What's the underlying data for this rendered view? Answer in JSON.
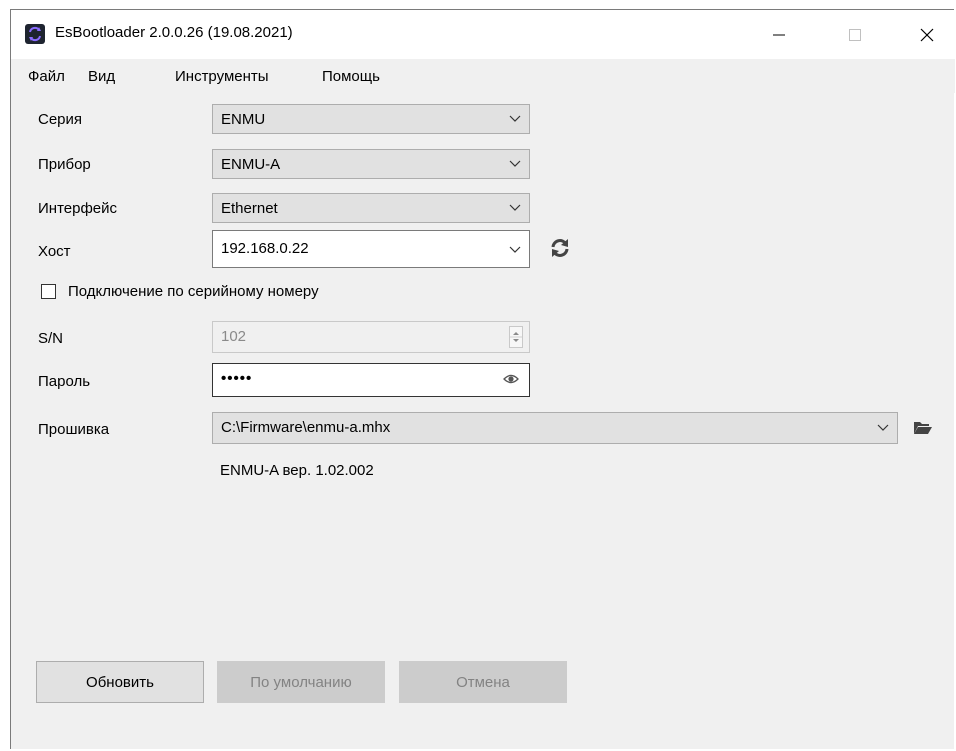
{
  "window": {
    "title": "EsBootloader 2.0.0.26 (19.08.2021)"
  },
  "menu": {
    "items": [
      "Файл",
      "Вид",
      "Инструменты",
      "Помощь"
    ]
  },
  "form": {
    "series_label": "Серия",
    "series_value": "ENMU",
    "device_label": "Прибор",
    "device_value": "ENMU-A",
    "interface_label": "Интерфейс",
    "interface_value": "Ethernet",
    "host_label": "Хост",
    "host_value": "192.168.0.22",
    "serial_checkbox_label": "Подключение по серийному номеру",
    "serial_checked": false,
    "sn_label": "S/N",
    "sn_value": "102",
    "password_label": "Пароль",
    "password_value": "•••••",
    "firmware_label": "Прошивка",
    "firmware_value": "C:\\Firmware\\enmu-a.mhx",
    "firmware_info": "ENMU-A вер. 1.02.002"
  },
  "buttons": {
    "update": "Обновить",
    "defaults": "По умолчанию",
    "cancel": "Отмена"
  },
  "icons": {
    "app": "app-icon",
    "refresh": "refresh-icon",
    "eye": "eye-icon",
    "folder": "folder-open-icon"
  }
}
